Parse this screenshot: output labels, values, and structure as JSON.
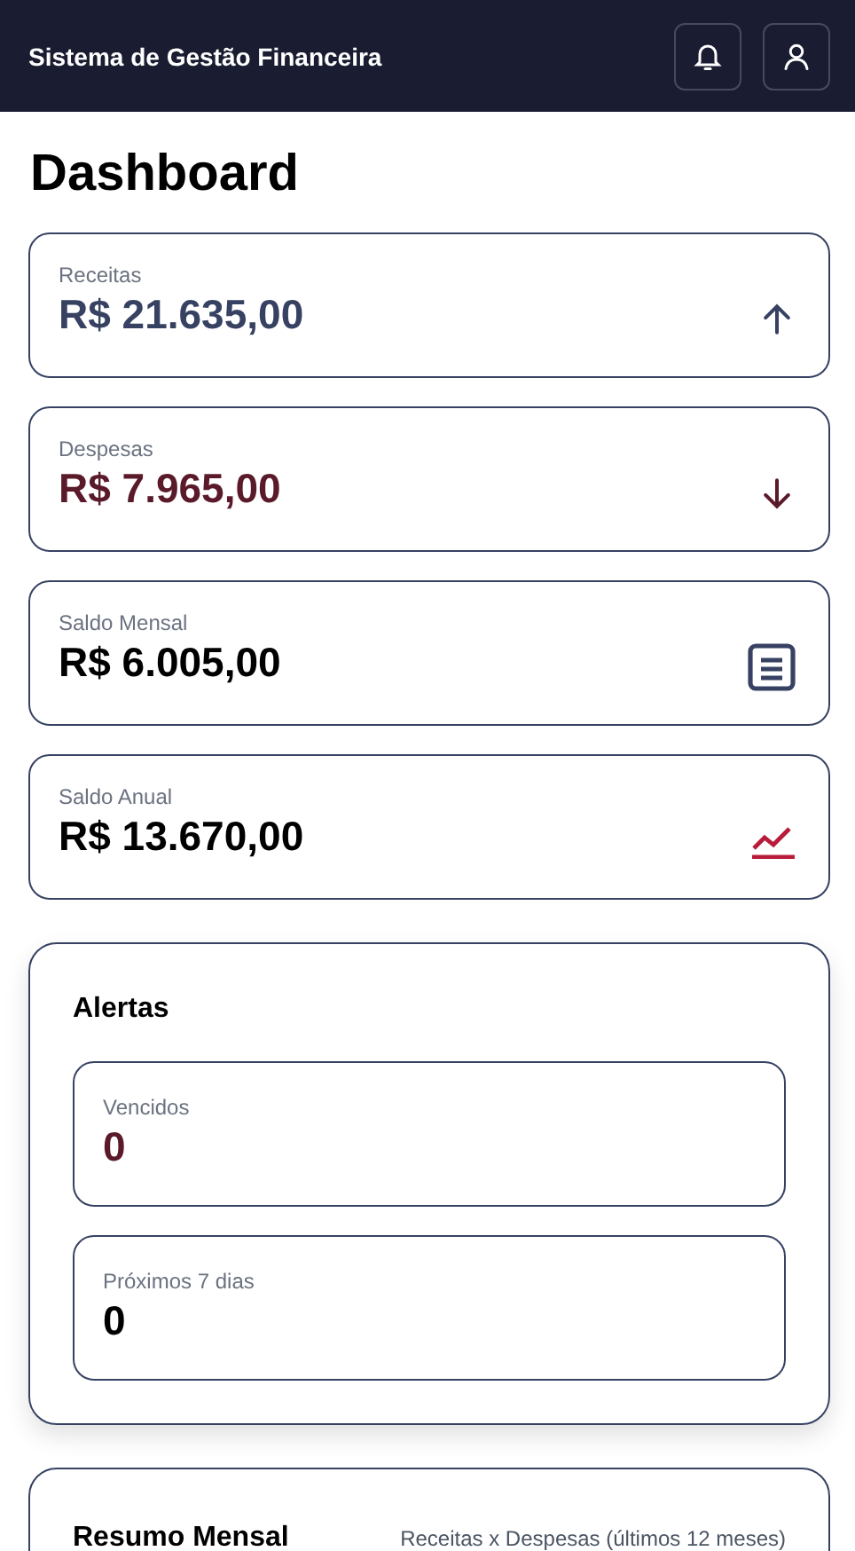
{
  "header": {
    "title": "Sistema de Gestão Financeira"
  },
  "page_title": "Dashboard",
  "summary_cards": [
    {
      "label": "Receitas",
      "value": "R$ 21.635,00",
      "kind": "up",
      "color": "#374263"
    },
    {
      "label": "Despesas",
      "value": "R$ 7.965,00",
      "kind": "down",
      "color": "#5a1a2a"
    },
    {
      "label": "Saldo Mensal",
      "value": "R$ 6.005,00",
      "kind": "document",
      "color": "#000000"
    },
    {
      "label": "Saldo Anual",
      "value": "R$ 13.670,00",
      "kind": "trend",
      "color": "#000000"
    }
  ],
  "alerts": {
    "title": "Alertas",
    "items": [
      {
        "label": "Vencidos",
        "value": "0",
        "color": "#5a1a2a"
      },
      {
        "label": "Próximos 7 dias",
        "value": "0",
        "color": "#000000"
      }
    ]
  },
  "monthly_summary": {
    "title": "Resumo Mensal",
    "subtitle": "Receitas x Despesas (últimos 12 meses)"
  }
}
